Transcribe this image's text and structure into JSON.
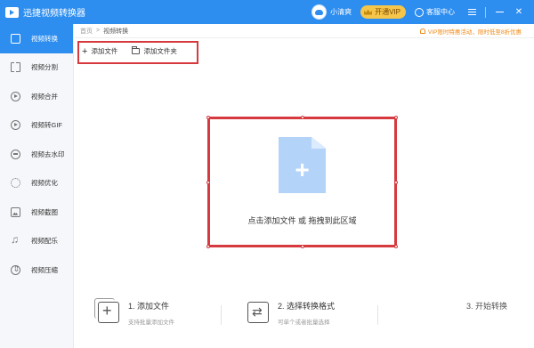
{
  "app": {
    "title": "迅捷视频转换器"
  },
  "user": {
    "name": "小清爽"
  },
  "header": {
    "vip_label": "开通VIP",
    "service_label": "客服中心"
  },
  "sidebar": {
    "items": [
      {
        "label": "视频转换",
        "icon": "video-convert-icon",
        "active": true
      },
      {
        "label": "视频分割",
        "icon": "video-split-icon"
      },
      {
        "label": "视频合并",
        "icon": "video-merge-icon"
      },
      {
        "label": "视频转GIF",
        "icon": "video-gif-icon"
      },
      {
        "label": "视频去水印",
        "icon": "watermark-icon"
      },
      {
        "label": "视频优化",
        "icon": "optimize-icon"
      },
      {
        "label": "视频截图",
        "icon": "screenshot-icon"
      },
      {
        "label": "视频配乐",
        "icon": "music-icon"
      },
      {
        "label": "视频压缩",
        "icon": "compress-icon"
      }
    ]
  },
  "breadcrumb": {
    "home": "首页",
    "separator": ">",
    "current": "视频转换"
  },
  "promo": {
    "text": "VIP限时特惠活动，限时低至8折优惠"
  },
  "toolbar": {
    "add_file": "添加文件",
    "add_folder": "添加文件夹"
  },
  "drop_zone": {
    "text": "点击添加文件 或 拖拽到此区域"
  },
  "steps": [
    {
      "title": "1. 添加文件",
      "desc": "支持批量添加文件"
    },
    {
      "title": "2. 选择转换格式",
      "desc": "可单个或者批量选择"
    },
    {
      "title": "3. 开始转换",
      "desc": ""
    }
  ],
  "colors": {
    "accent": "#2e8ef0",
    "highlight": "#d63a3f",
    "vip": "#f6c64a",
    "promo": "#f08a1a"
  }
}
